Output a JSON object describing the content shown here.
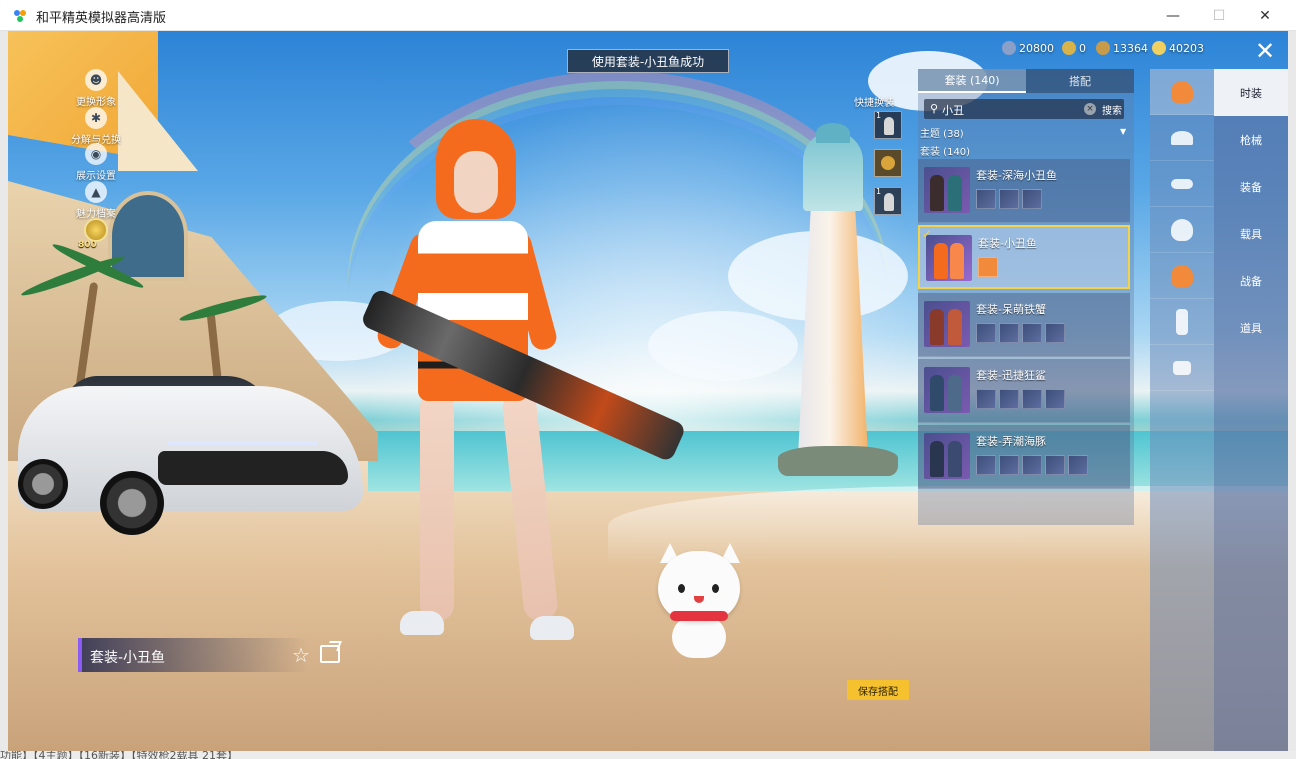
{
  "window": {
    "title": "和平精英模拟器高清版"
  },
  "footer_text": "功能】【4主题】【16新装】【特效枪2载具 21套】",
  "side_menu": [
    {
      "label": "更换形象",
      "icon": "person-icon"
    },
    {
      "label": "分解与兑换",
      "icon": "gear-icon"
    },
    {
      "label": "展示设置",
      "icon": "eye-icon"
    },
    {
      "label": "魅力档案",
      "icon": "flame-icon"
    }
  ],
  "badge": {
    "value": "800"
  },
  "toast": {
    "text": "使用套装-小丑鱼成功"
  },
  "currencies": [
    {
      "value": "20800",
      "color": "#8aa0c8"
    },
    {
      "value": "0",
      "color": "#d8b34a"
    },
    {
      "value": "13364",
      "color": "#c89b4a"
    },
    {
      "value": "40203",
      "color": "#f0d060"
    }
  ],
  "quick_change": {
    "label": "快捷换装",
    "slots": [
      "1",
      "",
      "1"
    ]
  },
  "panel": {
    "tabs": [
      "套装 (140)",
      "搭配"
    ],
    "search": {
      "value": "小丑",
      "button": "搜索"
    },
    "theme_label": "主题 (38)",
    "suit_label": "套装 (140)",
    "outfits": [
      {
        "name": "套装-深海小丑鱼",
        "parts": 3,
        "selected": false
      },
      {
        "name": "套装-小丑鱼",
        "parts": 1,
        "selected": true
      },
      {
        "name": "套装-呆萌铁蟹",
        "parts": 4,
        "selected": false
      },
      {
        "name": "套装-迅捷狂鲨",
        "parts": 4,
        "selected": false
      },
      {
        "name": "套装-弄潮海豚",
        "parts": 5,
        "selected": false
      }
    ]
  },
  "icon_column": [
    "outfit-icon",
    "hat-icon",
    "glasses-icon",
    "mask-icon",
    "top-icon",
    "pants-icon",
    "shoes-icon"
  ],
  "categories": [
    "时装",
    "枪械",
    "装备",
    "载具",
    "战备",
    "道具"
  ],
  "current_outfit": {
    "name": "套装-小丑鱼"
  },
  "save_button": "保存搭配"
}
